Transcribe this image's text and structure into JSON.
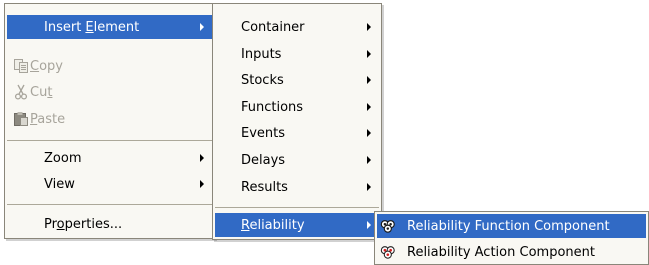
{
  "main_menu": {
    "insert_element": {
      "pre": "Insert ",
      "acc": "E",
      "post": "lement"
    },
    "copy": {
      "pre": "",
      "acc": "C",
      "post": "opy",
      "icon": "copy-icon"
    },
    "cut": {
      "pre": "Cu",
      "acc": "t",
      "post": "",
      "icon": "cut-icon"
    },
    "paste": {
      "pre": "",
      "acc": "P",
      "post": "aste",
      "icon": "paste-icon"
    },
    "zoom": "Zoom",
    "view": "View",
    "properties": {
      "pre": "Pr",
      "acc": "o",
      "post": "perties..."
    }
  },
  "insert_submenu": {
    "items": [
      "Container",
      "Inputs",
      "Stocks",
      "Functions",
      "Events",
      "Delays",
      "Results"
    ],
    "reliability": {
      "pre": "",
      "acc": "R",
      "post": "eliability"
    }
  },
  "reliability_submenu": {
    "items": [
      {
        "label": "Reliability Function Component",
        "icon": "reliability-function-icon",
        "highlighted": true
      },
      {
        "label": "Reliability Action Component",
        "icon": "reliability-action-icon",
        "highlighted": false
      }
    ]
  },
  "colors": {
    "highlight": "#316ac5",
    "menu_bg": "#f9f8f3",
    "disabled_text": "#a7a49b"
  }
}
